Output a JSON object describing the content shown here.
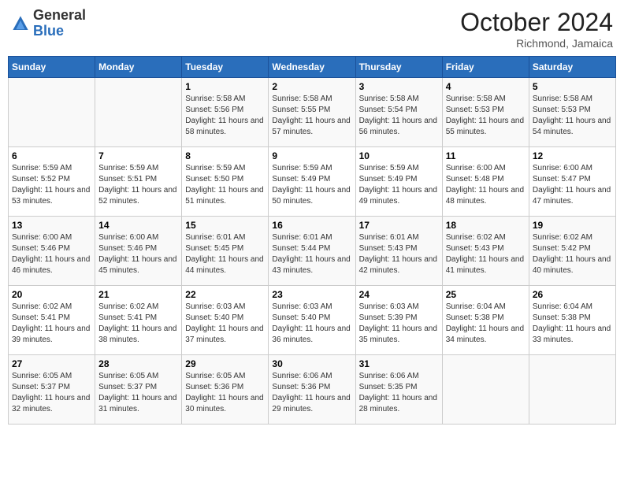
{
  "logo": {
    "general": "General",
    "blue": "Blue"
  },
  "header": {
    "month": "October 2024",
    "location": "Richmond, Jamaica"
  },
  "days_of_week": [
    "Sunday",
    "Monday",
    "Tuesday",
    "Wednesday",
    "Thursday",
    "Friday",
    "Saturday"
  ],
  "weeks": [
    [
      {
        "day": "",
        "info": ""
      },
      {
        "day": "",
        "info": ""
      },
      {
        "day": "1",
        "info": "Sunrise: 5:58 AM\nSunset: 5:56 PM\nDaylight: 11 hours and 58 minutes."
      },
      {
        "day": "2",
        "info": "Sunrise: 5:58 AM\nSunset: 5:55 PM\nDaylight: 11 hours and 57 minutes."
      },
      {
        "day": "3",
        "info": "Sunrise: 5:58 AM\nSunset: 5:54 PM\nDaylight: 11 hours and 56 minutes."
      },
      {
        "day": "4",
        "info": "Sunrise: 5:58 AM\nSunset: 5:53 PM\nDaylight: 11 hours and 55 minutes."
      },
      {
        "day": "5",
        "info": "Sunrise: 5:58 AM\nSunset: 5:53 PM\nDaylight: 11 hours and 54 minutes."
      }
    ],
    [
      {
        "day": "6",
        "info": "Sunrise: 5:59 AM\nSunset: 5:52 PM\nDaylight: 11 hours and 53 minutes."
      },
      {
        "day": "7",
        "info": "Sunrise: 5:59 AM\nSunset: 5:51 PM\nDaylight: 11 hours and 52 minutes."
      },
      {
        "day": "8",
        "info": "Sunrise: 5:59 AM\nSunset: 5:50 PM\nDaylight: 11 hours and 51 minutes."
      },
      {
        "day": "9",
        "info": "Sunrise: 5:59 AM\nSunset: 5:49 PM\nDaylight: 11 hours and 50 minutes."
      },
      {
        "day": "10",
        "info": "Sunrise: 5:59 AM\nSunset: 5:49 PM\nDaylight: 11 hours and 49 minutes."
      },
      {
        "day": "11",
        "info": "Sunrise: 6:00 AM\nSunset: 5:48 PM\nDaylight: 11 hours and 48 minutes."
      },
      {
        "day": "12",
        "info": "Sunrise: 6:00 AM\nSunset: 5:47 PM\nDaylight: 11 hours and 47 minutes."
      }
    ],
    [
      {
        "day": "13",
        "info": "Sunrise: 6:00 AM\nSunset: 5:46 PM\nDaylight: 11 hours and 46 minutes."
      },
      {
        "day": "14",
        "info": "Sunrise: 6:00 AM\nSunset: 5:46 PM\nDaylight: 11 hours and 45 minutes."
      },
      {
        "day": "15",
        "info": "Sunrise: 6:01 AM\nSunset: 5:45 PM\nDaylight: 11 hours and 44 minutes."
      },
      {
        "day": "16",
        "info": "Sunrise: 6:01 AM\nSunset: 5:44 PM\nDaylight: 11 hours and 43 minutes."
      },
      {
        "day": "17",
        "info": "Sunrise: 6:01 AM\nSunset: 5:43 PM\nDaylight: 11 hours and 42 minutes."
      },
      {
        "day": "18",
        "info": "Sunrise: 6:02 AM\nSunset: 5:43 PM\nDaylight: 11 hours and 41 minutes."
      },
      {
        "day": "19",
        "info": "Sunrise: 6:02 AM\nSunset: 5:42 PM\nDaylight: 11 hours and 40 minutes."
      }
    ],
    [
      {
        "day": "20",
        "info": "Sunrise: 6:02 AM\nSunset: 5:41 PM\nDaylight: 11 hours and 39 minutes."
      },
      {
        "day": "21",
        "info": "Sunrise: 6:02 AM\nSunset: 5:41 PM\nDaylight: 11 hours and 38 minutes."
      },
      {
        "day": "22",
        "info": "Sunrise: 6:03 AM\nSunset: 5:40 PM\nDaylight: 11 hours and 37 minutes."
      },
      {
        "day": "23",
        "info": "Sunrise: 6:03 AM\nSunset: 5:40 PM\nDaylight: 11 hours and 36 minutes."
      },
      {
        "day": "24",
        "info": "Sunrise: 6:03 AM\nSunset: 5:39 PM\nDaylight: 11 hours and 35 minutes."
      },
      {
        "day": "25",
        "info": "Sunrise: 6:04 AM\nSunset: 5:38 PM\nDaylight: 11 hours and 34 minutes."
      },
      {
        "day": "26",
        "info": "Sunrise: 6:04 AM\nSunset: 5:38 PM\nDaylight: 11 hours and 33 minutes."
      }
    ],
    [
      {
        "day": "27",
        "info": "Sunrise: 6:05 AM\nSunset: 5:37 PM\nDaylight: 11 hours and 32 minutes."
      },
      {
        "day": "28",
        "info": "Sunrise: 6:05 AM\nSunset: 5:37 PM\nDaylight: 11 hours and 31 minutes."
      },
      {
        "day": "29",
        "info": "Sunrise: 6:05 AM\nSunset: 5:36 PM\nDaylight: 11 hours and 30 minutes."
      },
      {
        "day": "30",
        "info": "Sunrise: 6:06 AM\nSunset: 5:36 PM\nDaylight: 11 hours and 29 minutes."
      },
      {
        "day": "31",
        "info": "Sunrise: 6:06 AM\nSunset: 5:35 PM\nDaylight: 11 hours and 28 minutes."
      },
      {
        "day": "",
        "info": ""
      },
      {
        "day": "",
        "info": ""
      }
    ]
  ]
}
